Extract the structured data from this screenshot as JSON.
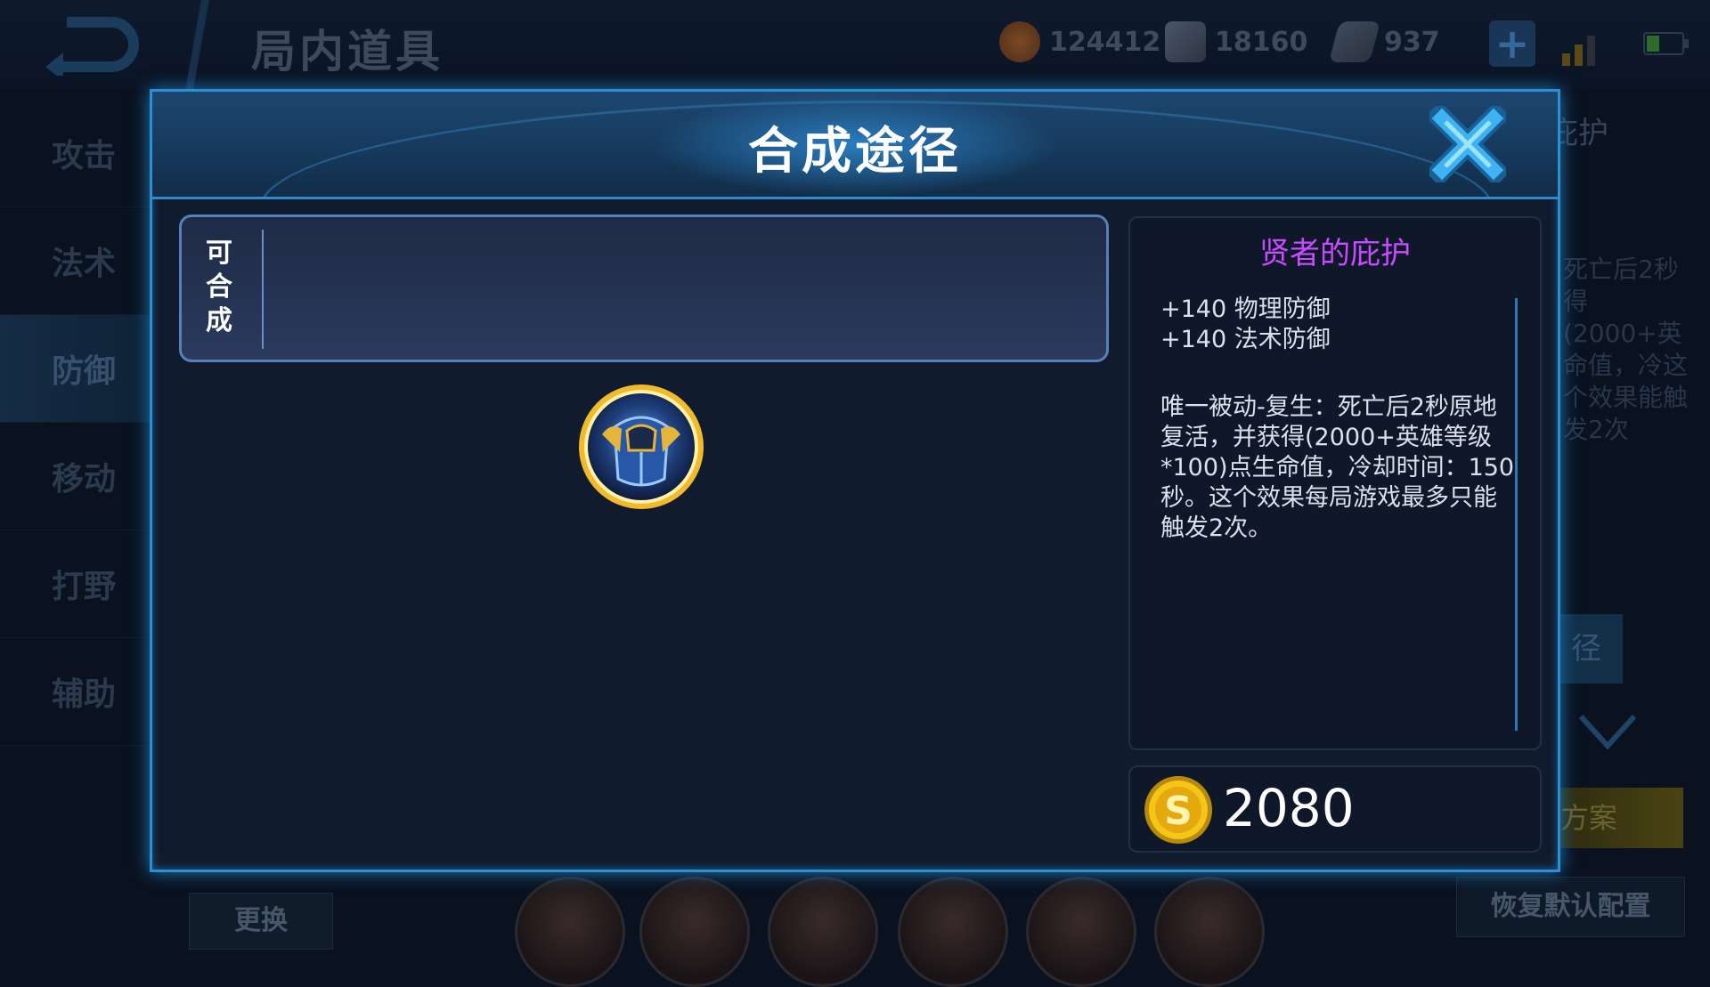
{
  "background": {
    "title": "局内道具",
    "currencies": [
      {
        "icon": "gold-coin-icon",
        "value": "124412"
      },
      {
        "icon": "diamond-icon",
        "value": "18160"
      },
      {
        "icon": "voucher-icon",
        "value": "937"
      }
    ],
    "categories": [
      "攻击",
      "法术",
      "防御",
      "移动",
      "打野",
      "辅助"
    ],
    "active_category": "防御",
    "right_title_partial": "庇护",
    "right_desc_partial": "死亡后2秒得(2000+英命值，冷这个效果能触发2次",
    "right_btn_partial": "径",
    "plan_partial": "方案",
    "restore_label": "恢复默认配置",
    "change_label": "更换"
  },
  "modal": {
    "title": "合成途径",
    "synth_label": "可合成",
    "item": {
      "name": "贤者的庇护",
      "stats": [
        "+140 物理防御",
        "+140 法术防御"
      ],
      "description": "唯一被动-复生：死亡后2秒原地复活，并获得(2000+英雄等级*100)点生命值，冷却时间：150秒。这个效果每局游戏最多只能触发2次。",
      "price": "2080",
      "name_color": "#c94bff"
    }
  }
}
